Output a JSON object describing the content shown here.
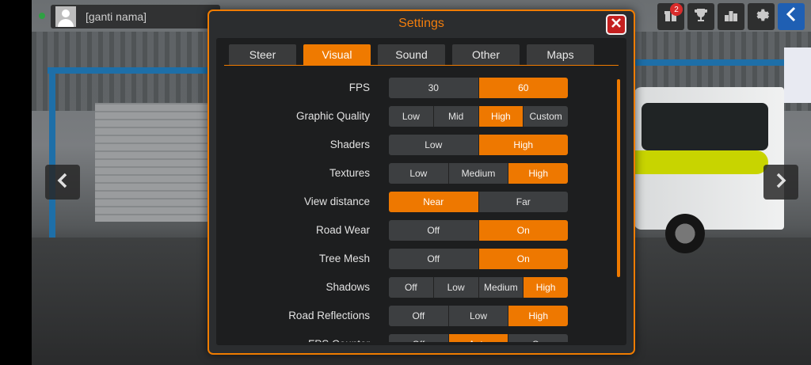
{
  "hud": {
    "player_name": "[ganti nama]",
    "notification_count": "2",
    "icons": [
      "gift-icon",
      "trophy-icon",
      "leaderboard-icon",
      "gear-icon",
      "back-arrow-icon"
    ]
  },
  "settings": {
    "title": "Settings",
    "tabs": [
      {
        "label": "Steer",
        "active": false
      },
      {
        "label": "Visual",
        "active": true
      },
      {
        "label": "Sound",
        "active": false
      },
      {
        "label": "Other",
        "active": false
      },
      {
        "label": "Maps",
        "active": false
      }
    ],
    "rows": [
      {
        "label": "FPS",
        "options": [
          "30",
          "60"
        ],
        "selected": 1
      },
      {
        "label": "Graphic Quality",
        "options": [
          "Low",
          "Mid",
          "High",
          "Custom"
        ],
        "selected": 2
      },
      {
        "label": "Shaders",
        "options": [
          "Low",
          "High"
        ],
        "selected": 1
      },
      {
        "label": "Textures",
        "options": [
          "Low",
          "Medium",
          "High"
        ],
        "selected": 2
      },
      {
        "label": "View distance",
        "options": [
          "Near",
          "Far"
        ],
        "selected": 0
      },
      {
        "label": "Road Wear",
        "options": [
          "Off",
          "On"
        ],
        "selected": 1
      },
      {
        "label": "Tree Mesh",
        "options": [
          "Off",
          "On"
        ],
        "selected": 1
      },
      {
        "label": "Shadows",
        "options": [
          "Off",
          "Low",
          "Medium",
          "High"
        ],
        "selected": 3
      },
      {
        "label": "Road Reflections",
        "options": [
          "Off",
          "Low",
          "High"
        ],
        "selected": 2
      },
      {
        "label": "FPS Counter",
        "options": [
          "Off",
          "Auto",
          "On"
        ],
        "selected": 1
      }
    ]
  },
  "colors": {
    "accent": "#ef7a00",
    "close": "#c42020",
    "panel": "#1d1e1f"
  }
}
